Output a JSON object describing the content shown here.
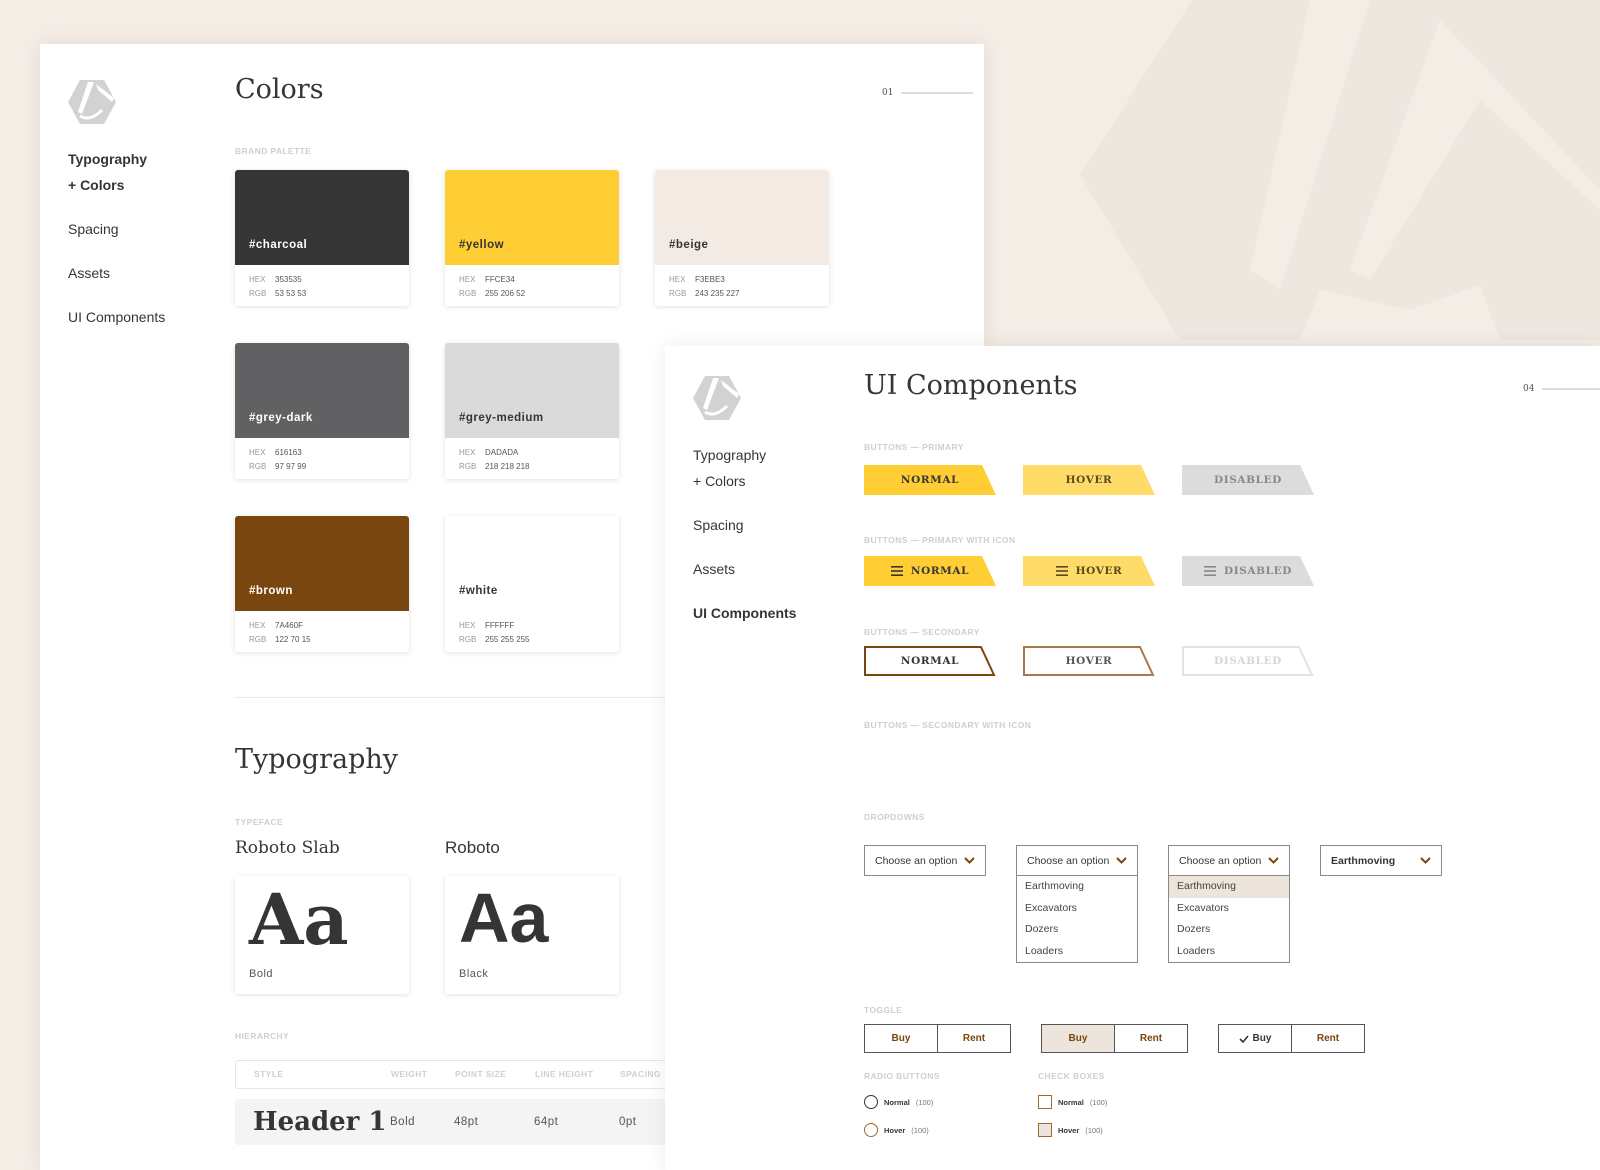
{
  "colors": {
    "charcoal": "#353535",
    "yellow": "#FFCE34",
    "beige": "#F3EBE3",
    "grey_dark": "#616163",
    "grey_medium": "#DADADA",
    "brown": "#7A460F",
    "white": "#FFFFFF",
    "yellow_hover": "#FFDC6A",
    "disabled_grey": "#DCDCDC",
    "background": "#F3EDE6"
  },
  "sheet1": {
    "nav": [
      {
        "label": "Typography",
        "active": true
      },
      {
        "label": "+ Colors",
        "active": true
      },
      {
        "label": "Spacing",
        "active": false
      },
      {
        "label": "Assets",
        "active": false
      },
      {
        "label": "UI Components",
        "active": false
      }
    ],
    "title": "Colors",
    "page_number": "01",
    "brand_palette_label": "BRAND PALETTE",
    "hex_label": "HEX",
    "rgb_label": "RGB",
    "swatches": [
      {
        "name": "#charcoal",
        "hex": "353535",
        "rgb": "53 53 53",
        "color": "#353535",
        "text": "#ffffff"
      },
      {
        "name": "#yellow",
        "hex": "FFCE34",
        "rgb": "255 206 52",
        "color": "#FFCE34",
        "text": "#353535"
      },
      {
        "name": "#beige",
        "hex": "F3EBE3",
        "rgb": "243 235 227",
        "color": "#F3EBE3",
        "text": "#353535"
      },
      {
        "name": "#grey-dark",
        "hex": "616163",
        "rgb": "97 97 99",
        "color": "#616163",
        "text": "#ffffff"
      },
      {
        "name": "#grey-medium",
        "hex": "DADADA",
        "rgb": "218 218 218",
        "color": "#DADADA",
        "text": "#353535"
      },
      {
        "name": "#brown",
        "hex": "7A460F",
        "rgb": "122 70 15",
        "color": "#7A460F",
        "text": "#ffffff"
      },
      {
        "name": "#white",
        "hex": "FFFFFF",
        "rgb": "255 255 255",
        "color": "#FFFFFF",
        "text": "#353535"
      }
    ],
    "typography_title": "Typography",
    "typeface_label": "TYPEFACE",
    "typefaces": [
      {
        "name": "Roboto Slab",
        "sample": "Aa",
        "weight": "Bold"
      },
      {
        "name": "Roboto",
        "sample": "Aa",
        "weight": "Black"
      }
    ],
    "hierarchy_label": "HIERARCHY",
    "hierarchy_columns": [
      "STYLE",
      "WEIGHT",
      "POINT SIZE",
      "LINE HEIGHT",
      "SPACING"
    ],
    "hierarchy_rows": [
      {
        "style": "Header 1",
        "weight": "Bold",
        "point_size": "48pt",
        "line_height": "64pt",
        "spacing": "0pt"
      }
    ]
  },
  "sheet2": {
    "nav": [
      {
        "label": "Typography",
        "active": false
      },
      {
        "label": "+ Colors",
        "active": false
      },
      {
        "label": "Spacing",
        "active": false
      },
      {
        "label": "Assets",
        "active": false
      },
      {
        "label": "UI Components",
        "active": true
      }
    ],
    "title": "UI Components",
    "page_number": "04",
    "buttons_primary_label": "BUTTONS — PRIMARY",
    "buttons_primary_icon_label": "BUTTONS — PRIMARY WITH ICON",
    "buttons_secondary_label": "BUTTONS — SECONDARY",
    "buttons_secondary_icon_label": "BUTTONS — SECONDARY WITH ICON",
    "button_states": [
      "NORMAL",
      "HOVER",
      "DISABLED"
    ],
    "dropdowns_label": "DROPDOWNS",
    "dropdown_placeholder": "Choose an option",
    "dropdown_selected": "Earthmoving",
    "dropdown_options": [
      "Earthmoving",
      "Excavators",
      "Dozers",
      "Loaders"
    ],
    "toggle_label": "TOGGLE",
    "toggle_options": [
      "Buy",
      "Rent"
    ],
    "radio_label": "RADIO BUTTONS",
    "checkbox_label": "CHECK BOXES",
    "option_states": [
      {
        "name": "Normal",
        "count": "(100)"
      },
      {
        "name": "Hover",
        "count": "(100)"
      }
    ]
  }
}
